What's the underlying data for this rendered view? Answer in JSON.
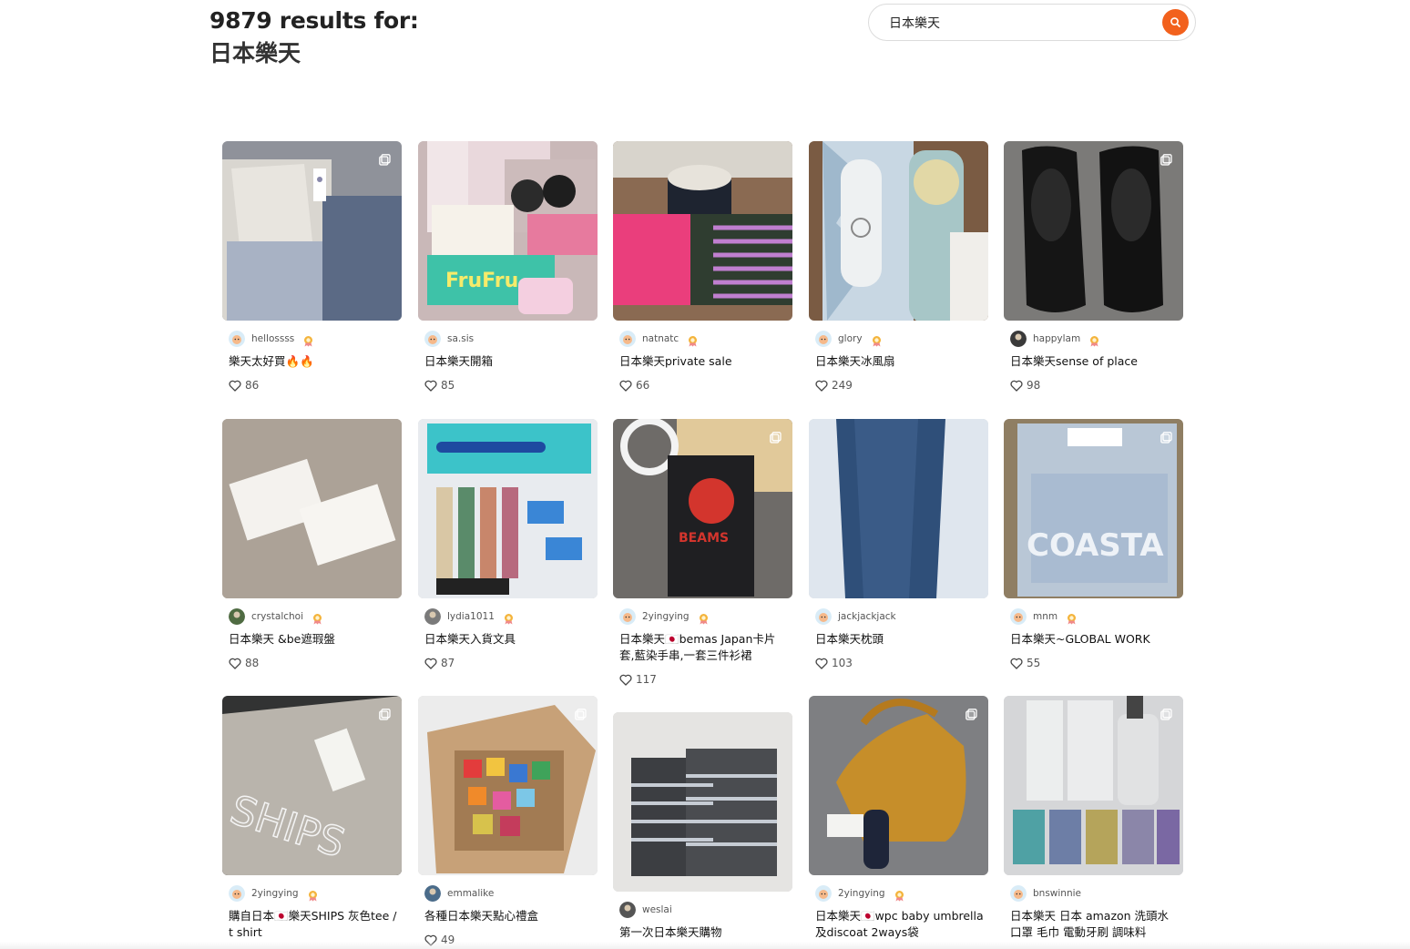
{
  "header": {
    "results_line": "9879 results for:",
    "query_line": "日本樂天"
  },
  "search": {
    "value": "日本樂天",
    "icon": "search-icon",
    "accent_color": "#f2611d"
  },
  "posts": [
    {
      "author": "hellossss",
      "title": "樂天太好買🔥🔥",
      "likes": "86",
      "multi": true,
      "badge": true
    },
    {
      "author": "sa.sis",
      "title": "日本樂天開箱",
      "likes": "85",
      "multi": false,
      "badge": false
    },
    {
      "author": "natnatc",
      "title": "日本樂天private sale",
      "likes": "66",
      "multi": false,
      "badge": true
    },
    {
      "author": "glory",
      "title": "日本樂天冰風扇",
      "likes": "249",
      "multi": false,
      "badge": true
    },
    {
      "author": "happylam",
      "title": "日本樂天sense of place",
      "likes": "98",
      "multi": true,
      "badge": true
    },
    {
      "author": "crystalchoi",
      "title": "日本樂天 &be遮瑕盤",
      "likes": "88",
      "multi": false,
      "badge": true
    },
    {
      "author": "lydia1011",
      "title": "日本樂天入貨文具",
      "likes": "87",
      "multi": false,
      "badge": true
    },
    {
      "author": "2yingying",
      "title": "日本樂天🇯🇵bemas Japan卡片套,藍染手串,一套三件衫裙",
      "likes": "117",
      "multi": true,
      "badge": true
    },
    {
      "author": "jackjackjack",
      "title": "日本樂天枕頭",
      "likes": "103",
      "multi": false,
      "badge": false
    },
    {
      "author": "mnm",
      "title": "日本樂天~GLOBAL WORK",
      "likes": "55",
      "multi": true,
      "badge": true
    },
    {
      "author": "2yingying",
      "title": "購自日本🇯🇵樂天SHIPS 灰色tee / t shirt",
      "likes": "",
      "multi": true,
      "badge": true
    },
    {
      "author": "emmalike",
      "title": "各種日本樂天點心禮盒",
      "likes": "49",
      "multi": true,
      "badge": false
    },
    {
      "author": "weslai",
      "title": "第一次日本樂天購物",
      "likes": "",
      "multi": false,
      "badge": false
    },
    {
      "author": "2yingying",
      "title": "日本樂天🇯🇵wpc baby umbrella 及discoat 2ways袋",
      "likes": "",
      "multi": true,
      "badge": true
    },
    {
      "author": "bnswinnie",
      "title": "日本樂天 日本 amazon 洗頭水 口罩 毛巾 電動牙刷 調味料",
      "likes": "",
      "multi": true,
      "badge": false
    }
  ],
  "icons": {
    "like": "heart-icon",
    "multi": "multiple-images-icon",
    "badge": "creator-badge-icon"
  }
}
